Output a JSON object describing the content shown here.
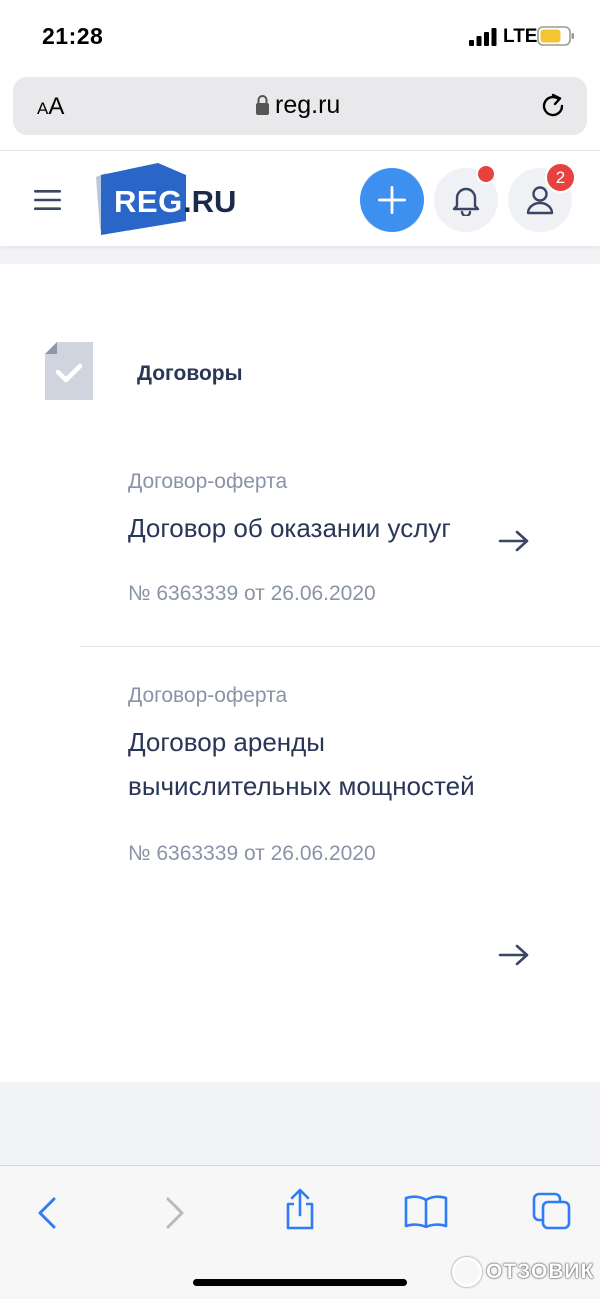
{
  "status_bar": {
    "time": "21:28",
    "network": "LTE"
  },
  "address_bar": {
    "text_size_label": "AA",
    "url": "reg.ru"
  },
  "header": {
    "logo_reg": "REG",
    "logo_ru": ".RU",
    "user_badge_count": "2"
  },
  "section": {
    "title": "Договоры"
  },
  "contracts": [
    {
      "type": "Договор-оферта",
      "title": "Договор об оказании услуг",
      "number": "№ 6363339 от 26.06.2020"
    },
    {
      "type": "Договор-оферта",
      "title": "Договор аренды вычислительных мощностей",
      "number": "№ 6363339 от 26.06.2020"
    }
  ],
  "watermark": {
    "text": "ОТЗОВИК"
  },
  "colors": {
    "accent": "#3d8ff0",
    "badge": "#e8413f",
    "logo_blue": "#2a66c8",
    "text_dark": "#2a3656",
    "text_muted": "#8a93a8"
  },
  "icons": [
    "signal-icon",
    "battery-icon",
    "lock-icon",
    "reload-icon",
    "menu-icon",
    "plus-icon",
    "bell-icon",
    "user-icon",
    "document-check-icon",
    "arrow-right-icon",
    "back-icon",
    "forward-icon",
    "share-icon",
    "bookmarks-icon",
    "tabs-icon"
  ]
}
